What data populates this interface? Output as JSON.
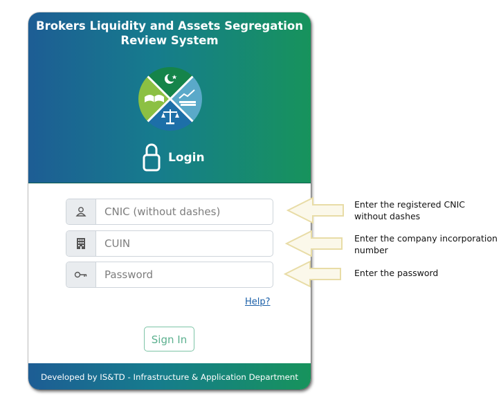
{
  "header": {
    "title_line1": "Brokers Liquidity and Assets Segregation",
    "title_line2": "Review System",
    "login_label": "Login"
  },
  "form": {
    "cnic_placeholder": "CNIC (without dashes)",
    "cuin_placeholder": "CUIN",
    "password_placeholder": "Password",
    "help_label": "Help?",
    "signin_label": "Sign In"
  },
  "footer": {
    "text": "Developed by IS&TD - Infrastructure & Application Department"
  },
  "annotations": {
    "cnic_line1": "Enter the registered CNIC",
    "cnic_line2": "without dashes",
    "cuin_line1": "Enter the company incorporation",
    "cuin_line2": "number",
    "password": "Enter the password"
  },
  "colors": {
    "gradient_start": "#1d5d94",
    "gradient_end": "#17935c",
    "signin_border": "#7cc4a6",
    "arrow": "#f3ecc4"
  }
}
